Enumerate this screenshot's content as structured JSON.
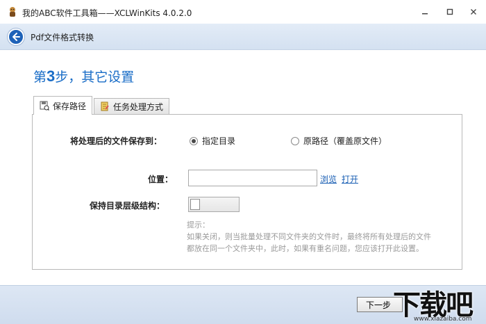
{
  "window": {
    "title": "我的ABC软件工具箱——XCLWinKits  4.0.2.0",
    "icon": "app-logo-icon"
  },
  "header": {
    "title": "Pdf文件格式转换",
    "back_icon": "back-arrow-icon"
  },
  "step": {
    "prefix": "第",
    "number": "3",
    "suffix": "步，其它设置"
  },
  "tabs": [
    {
      "label": "保存路径",
      "icon": "save-path-icon",
      "active": true
    },
    {
      "label": "任务处理方式",
      "icon": "task-mode-icon",
      "active": false
    }
  ],
  "save_to": {
    "label": "将处理后的文件保存到：",
    "options": [
      {
        "label": "指定目录",
        "selected": true
      },
      {
        "label": "原路径（覆盖原文件）",
        "selected": false
      }
    ]
  },
  "location": {
    "label": "位置：",
    "value": "",
    "browse_label": "浏览",
    "open_label": "打开"
  },
  "keep_structure": {
    "label": "保持目录层级结构：",
    "enabled": false
  },
  "hint": {
    "title": "提示：",
    "line1": "如果关闭，则当批量处理不同文件夹的文件时，最终将所有处理后的文件",
    "line2": "都放在同一个文件夹中，此时，如果有重名问题，您应该打开此设置。"
  },
  "footer": {
    "next_label": "下一步"
  },
  "watermark": {
    "brand": "下载吧",
    "url": "www.xiazaiba.com"
  },
  "colors": {
    "accent": "#1a6dc7",
    "header_bg": "#dbe6f4",
    "link": "#1a5fb4",
    "hint_text": "#9a9a9a"
  }
}
